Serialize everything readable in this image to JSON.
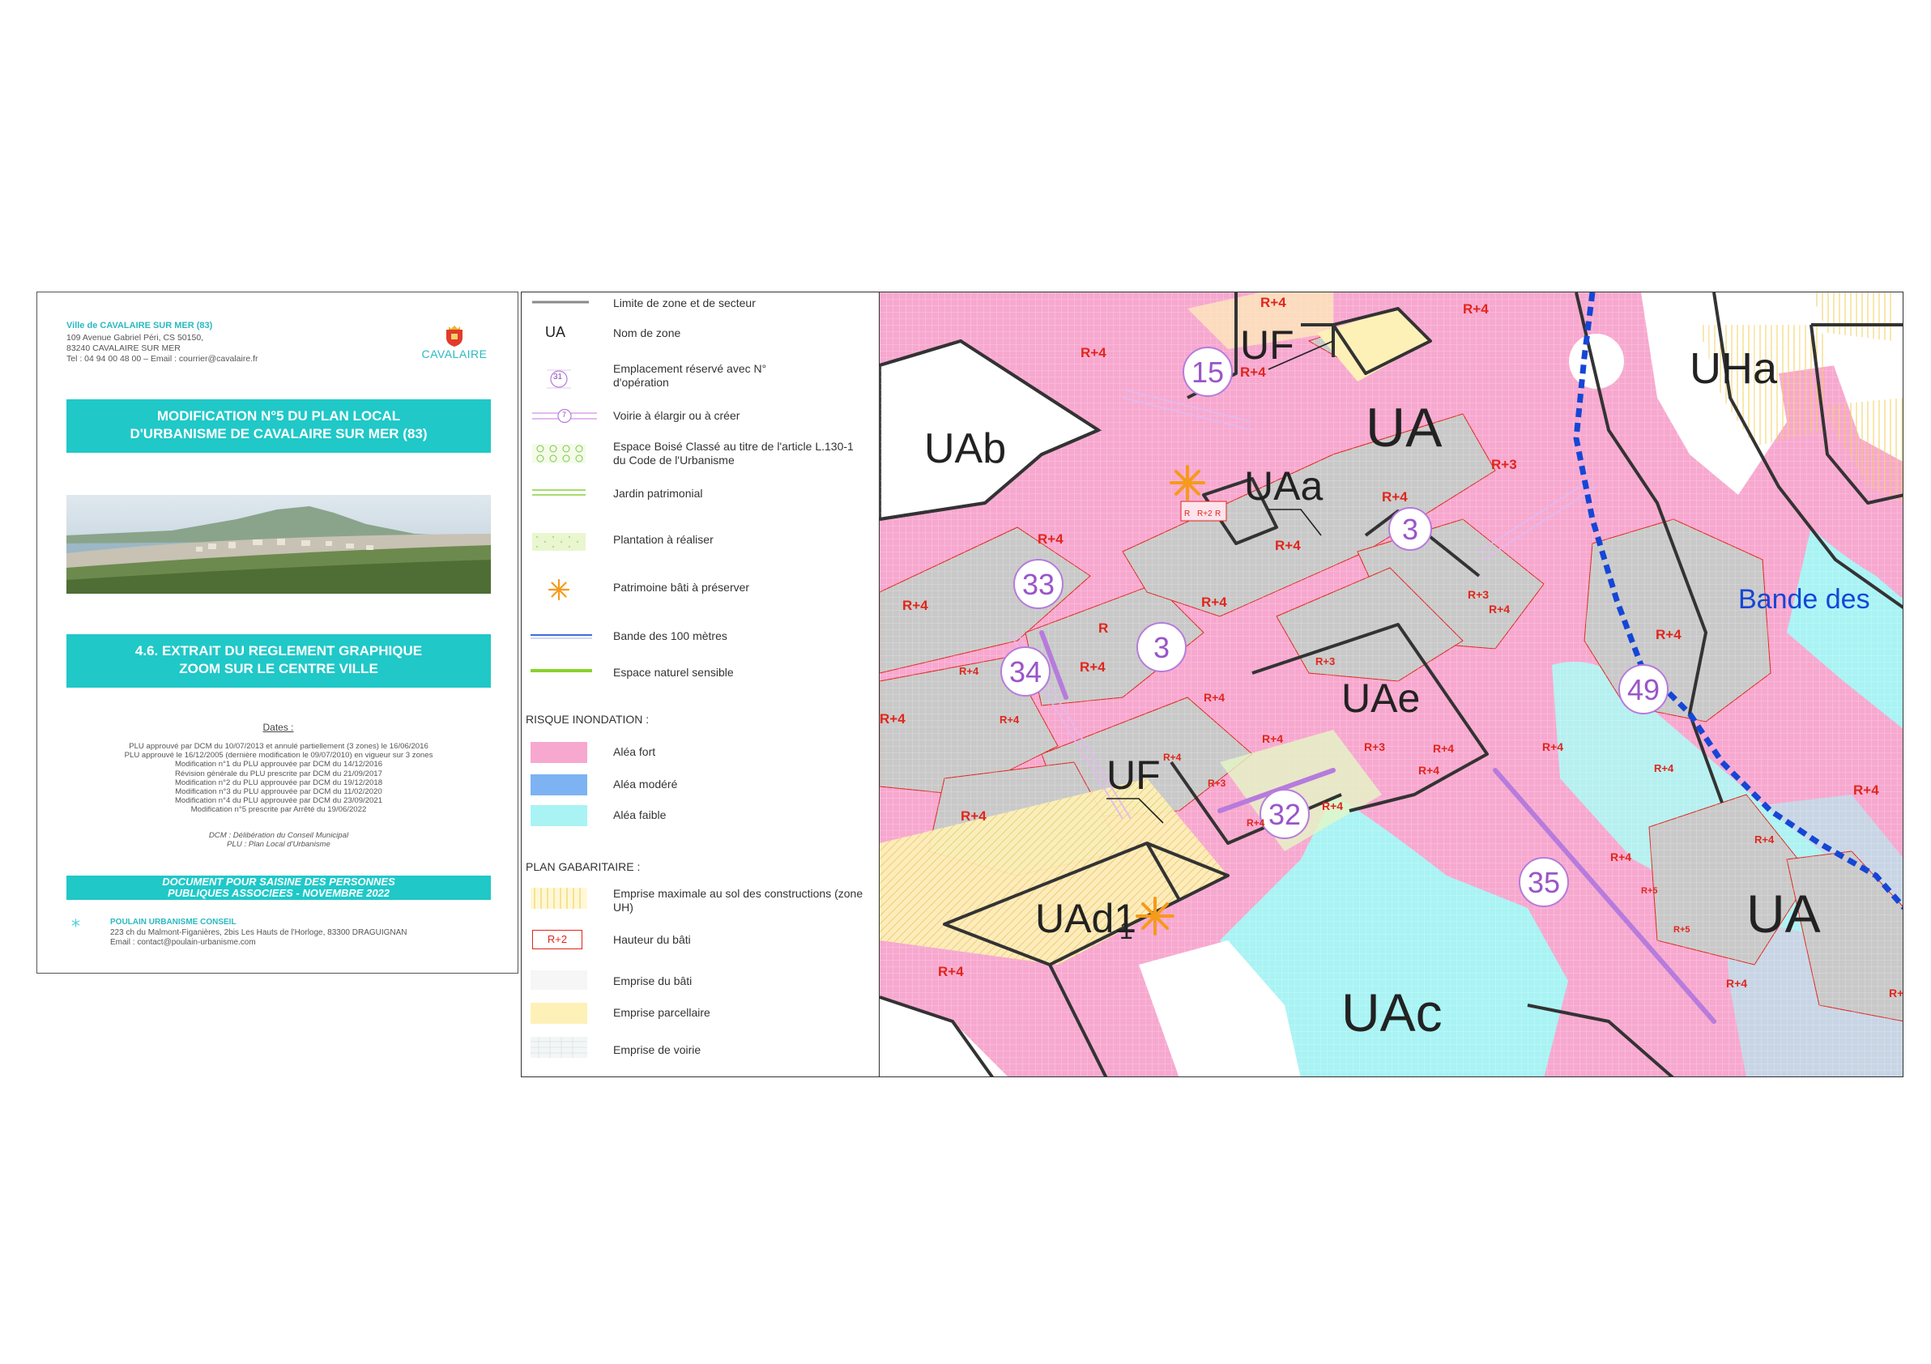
{
  "cartouche": {
    "org_name": "Ville de CAVALAIRE SUR MER (83)",
    "address_lines": [
      "109 Avenue Gabriel Péri, CS 50150,",
      "83240 CAVALAIRE SUR MER",
      "Tel : 04 94 00 48 00 – Email : courrier@cavalaire.fr"
    ],
    "logo_text": "CAVALAIRE",
    "title_lines": [
      "MODIFICATION N°5 DU PLAN LOCAL",
      "D'URBANISME DE CAVALAIRE SUR MER (83)"
    ],
    "subtitle_lines": [
      "4.6. EXTRAIT DU REGLEMENT GRAPHIQUE",
      "ZOOM SUR LE CENTRE VILLE"
    ],
    "dates_title": "Dates :",
    "dates": [
      "PLU approuvé par DCM du 10/07/2013 et annulé partiellement (3 zones) le 16/06/2016",
      "PLU approuvé le 16/12/2005 (dernière modification le 09/07/2010) en vigueur sur 3 zones",
      "Modification n°1 du PLU approuvée par DCM du 14/12/2016",
      "Révision générale du PLU prescrite par DCM du 21/09/2017",
      "Modification n°2 du PLU approuvée par DCM du 19/12/2018",
      "Modification n°3 du PLU approuvée par DCM du 11/02/2020",
      "Modification n°4 du PLU approuvée par DCM du 23/09/2021",
      "Modification n°5 prescrite par Arrêté du 19/06/2022"
    ],
    "abbreviations": [
      "DCM : Délibération du Conseil Municipal",
      "PLU : Plan Local d'Urbanisme"
    ],
    "status_lines": [
      "DOCUMENT POUR SAISINE DES PERSONNES",
      "PUBLIQUES ASSOCIEES - NOVEMBRE 2022"
    ],
    "consultant_name": "POULAIN URBANISME CONSEIL",
    "consultant_lines": [
      "223 ch du Malmont-Figanières, 2bis Les Hauts de l'Horloge, 83300 DRAGUIGNAN",
      "Email : contact@poulain-urbanisme.com"
    ]
  },
  "legend": {
    "items": [
      {
        "label": "Limite de zone et de secteur",
        "symbol": "line-grey"
      },
      {
        "label": "Nom de zone",
        "symbol_text": "UA"
      },
      {
        "label": "Emplacement réservé avec N° d'opération",
        "symbol_text": "31"
      },
      {
        "label": "Voirie à élargir ou à créer",
        "symbol_text": "7"
      },
      {
        "label": "Espace Boisé Classé au titre de l'article L.130-1 du Code de l'Urbanisme",
        "symbol": "ebc"
      },
      {
        "label": "Jardin patrimonial",
        "symbol": "garden"
      },
      {
        "label": "Plantation à réaliser",
        "symbol": "plantation"
      },
      {
        "label": "Patrimoine bâti à préserver",
        "symbol": "asterisk"
      },
      {
        "label": "Bande des 100 mètres",
        "symbol": "band"
      },
      {
        "label": "Espace naturel sensible",
        "symbol": "green-line"
      }
    ],
    "flood_title": "RISQUE INONDATION :",
    "flood_items": [
      {
        "label": "Aléa fort",
        "color": "#f7a8cf"
      },
      {
        "label": "Aléa modéré",
        "color": "#7db3f2"
      },
      {
        "label": "Aléa faible",
        "color": "#a9f3f4"
      }
    ],
    "plan_title": "PLAN GABARITAIRE :",
    "plan_items": [
      {
        "label": "Emprise maximale au sol des constructions (zone UH)",
        "symbol": "yellow-hatch"
      },
      {
        "label": "Hauteur du bâti",
        "symbol_text": "R+2"
      },
      {
        "label": "Emprise du bâti",
        "symbol": "light-grid"
      },
      {
        "label": "Emprise parcellaire",
        "color": "#fdf1b8"
      },
      {
        "label": "Emprise de voirie",
        "symbol": "grid"
      }
    ]
  },
  "map": {
    "zones": [
      "UF",
      "UHa",
      "UA",
      "UAb",
      "UAa",
      "UAe",
      "UF",
      "UAd1",
      "UAc",
      "UA"
    ],
    "zone_subscript": "1",
    "band_label": "Bande des",
    "reserved_numbers": [
      "15",
      "3",
      "33",
      "3",
      "34",
      "49",
      "32",
      "35"
    ],
    "heights": [
      "R+4",
      "R+4",
      "R+4",
      "R+4",
      "R+3",
      "R+4",
      "R+4",
      "R+4",
      "R+4",
      "R+4",
      "R",
      "R+4",
      "R+4",
      "R+4",
      "R+3",
      "R+4",
      "R+4",
      "R+4",
      "R+3",
      "R+4",
      "R+3",
      "R+4",
      "R+4",
      "R+4",
      "R+4",
      "R+3",
      "R+4",
      "R+4",
      "R+4",
      "R+4",
      "R+4",
      "R+4",
      "R+4",
      "R+5",
      "R+5",
      "R+4",
      "R+4",
      "R+4",
      "R+4"
    ],
    "small_heights": [
      "R",
      "R+2",
      "R"
    ],
    "colors": {
      "flood_high": "#f7a8cf",
      "flood_low": "#a9f3f4",
      "parcel": "#fdf1b8",
      "built": "#c9c9c9",
      "red": "#e0261c",
      "purple": "#b67bdc",
      "blue": "#1546d6"
    }
  }
}
